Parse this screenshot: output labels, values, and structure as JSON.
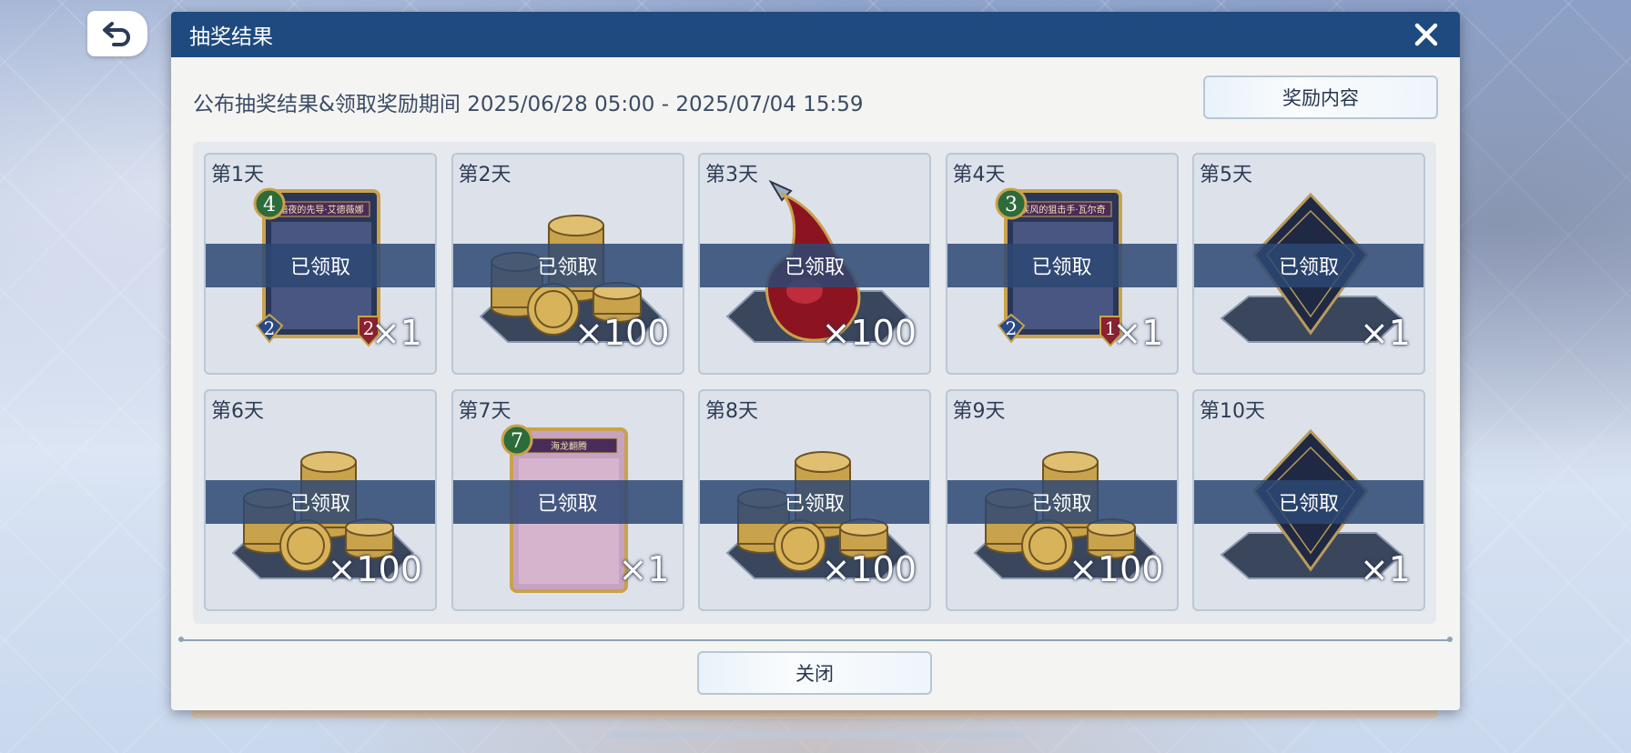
{
  "dialog": {
    "title": "抽奖结果",
    "period": "公布抽奖结果&领取奖励期间 2025/06/28 05:00 - 2025/07/04 15:59",
    "reward_button": "奖励内容",
    "close_button": "关闭"
  },
  "claimed_label": "已领取",
  "cards": [
    {
      "day": "第1天",
      "qty": "×1",
      "item": "card",
      "cost": "4",
      "stat_l": "2",
      "stat_r": "2",
      "name": "暗夜的先导·艾德薇娜"
    },
    {
      "day": "第2天",
      "qty": "×100",
      "item": "coins"
    },
    {
      "day": "第3天",
      "qty": "×100",
      "item": "potion"
    },
    {
      "day": "第4天",
      "qty": "×1",
      "item": "card",
      "cost": "3",
      "stat_l": "2",
      "stat_r": "1",
      "name": "疾风的狙击手·瓦尔奇"
    },
    {
      "day": "第5天",
      "qty": "×1",
      "item": "sleeve"
    },
    {
      "day": "第6天",
      "qty": "×100",
      "item": "coins"
    },
    {
      "day": "第7天",
      "qty": "×1",
      "item": "spell",
      "cost": "7",
      "name": "海龙翻腾"
    },
    {
      "day": "第8天",
      "qty": "×100",
      "item": "coins"
    },
    {
      "day": "第9天",
      "qty": "×100",
      "item": "coins"
    },
    {
      "day": "第10天",
      "qty": "×1",
      "item": "sleeve"
    }
  ],
  "colors": {
    "titlebar": "#1f4a80",
    "band": "#2d4873",
    "coin": "#c9a24c"
  }
}
